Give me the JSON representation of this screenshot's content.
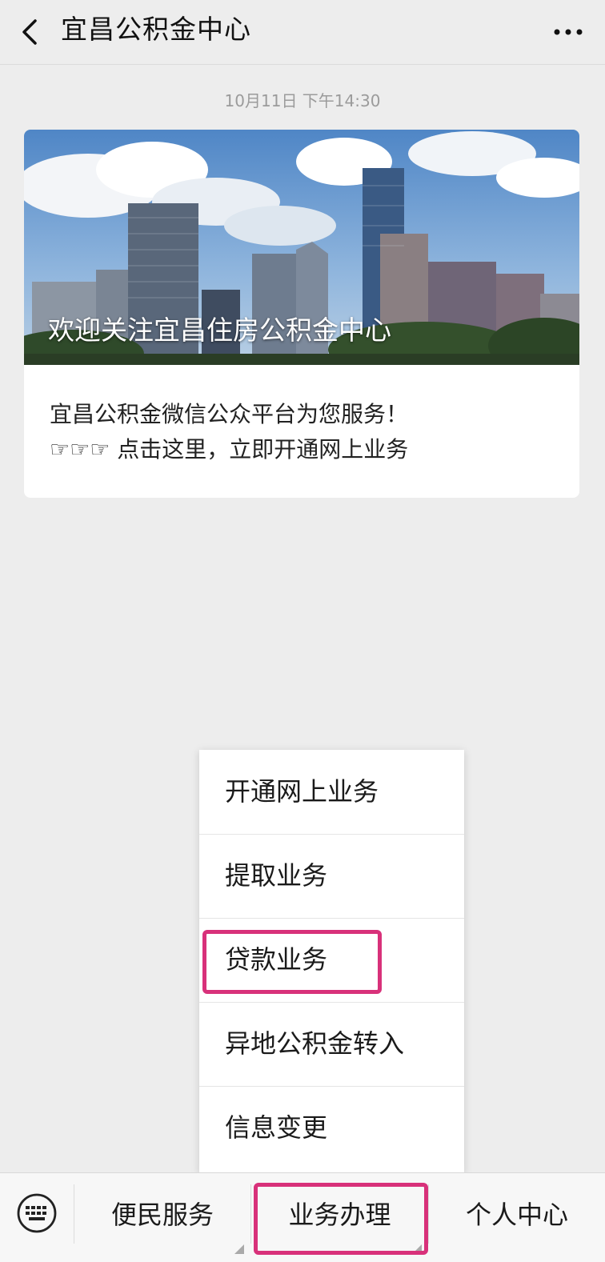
{
  "header": {
    "title": "宜昌公积金中心",
    "back_icon": "chevron-left-icon",
    "more_icon": "more-dots-icon"
  },
  "timestamp": "10月11日 下午14:30",
  "article": {
    "image_caption": "欢迎关注宜昌住房公积金中心",
    "line1": "宜昌公积金微信公众平台为您服务！",
    "line2": "☞☞☞ 点击这里，立即开通网上业务"
  },
  "popup_menu": {
    "items": [
      {
        "label": "开通网上业务"
      },
      {
        "label": "提取业务"
      },
      {
        "label": "贷款业务"
      },
      {
        "label": "异地公积金转入"
      },
      {
        "label": "信息变更"
      }
    ],
    "highlighted_label": "贷款业务"
  },
  "bottom_menu": {
    "keyboard_icon": "keyboard-icon",
    "tabs": [
      {
        "label": "便民服务"
      },
      {
        "label": "业务办理"
      },
      {
        "label": "个人中心"
      }
    ],
    "highlighted_tab": "业务办理"
  },
  "colors": {
    "background": "#ededed",
    "highlight": "#d8317a",
    "card": "#ffffff"
  }
}
